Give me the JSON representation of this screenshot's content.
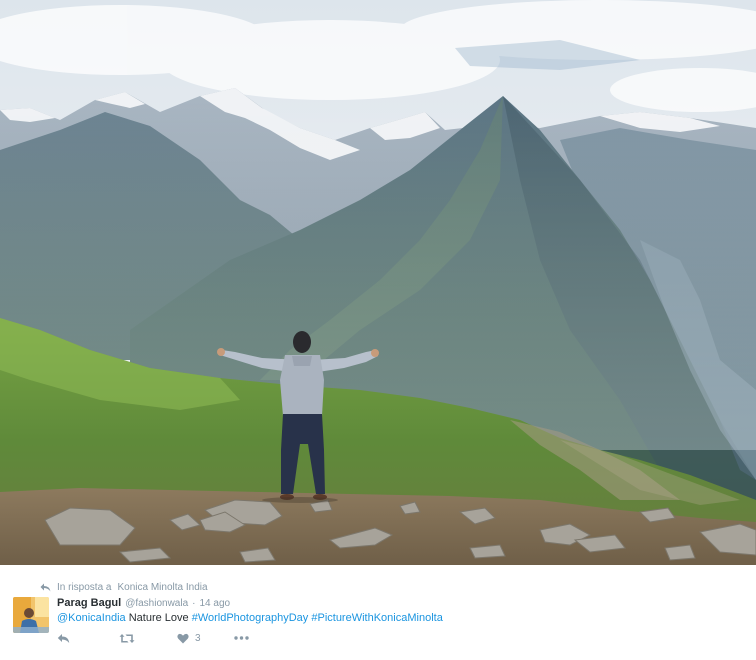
{
  "photo": {
    "subject": "mountain-landscape"
  },
  "tweet": {
    "reply_prefix": "In risposta a",
    "reply_target": "Konica Minolta India",
    "author": {
      "display_name": "Parag Bagul",
      "handle": "@fashionwala"
    },
    "separator": "·",
    "timestamp": "14 ago",
    "text": {
      "mention": "@KonicaIndia",
      "body": " Nature Love ",
      "hashtag_1": "#WorldPhotographyDay",
      "space": " ",
      "hashtag_2": "#PictureWithKonicaMinolta"
    },
    "actions": {
      "like_count": "3"
    }
  },
  "colors": {
    "link": "#1b95e0",
    "muted": "#8899a6",
    "text": "#292f33"
  }
}
